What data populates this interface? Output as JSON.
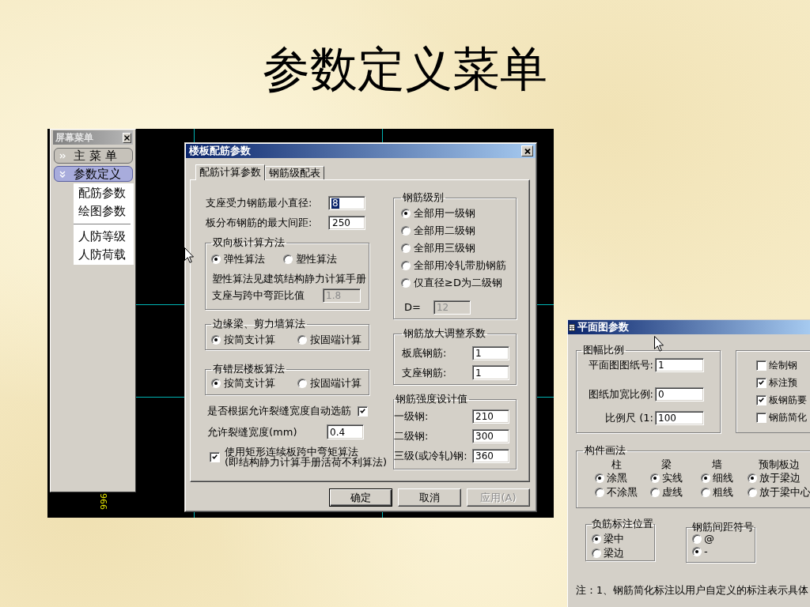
{
  "slide": {
    "title": "参数定义菜单"
  },
  "cad_screen": {
    "canvas_text": "966",
    "screen_menu": {
      "title": "屏幕菜单",
      "buttons": [
        {
          "label": "主 菜 单",
          "expanded": false
        },
        {
          "label": "参数定义",
          "expanded": true,
          "item_groups": [
            [
              "配筋参数",
              "绘图参数"
            ],
            [
              "人防等级",
              "人防荷载"
            ]
          ]
        }
      ]
    },
    "dialog": {
      "title": "楼板配筋参数",
      "tabs": [
        {
          "label": "配筋计算参数",
          "selected": true
        },
        {
          "label": "钢筋级配表",
          "selected": false
        }
      ],
      "fields": [
        {
          "label": "支座受力钢筋最小直径:",
          "value": "8",
          "text_selected": true
        },
        {
          "label": "板分布钢筋的最大间距:",
          "value": "250",
          "text_selected": false
        }
      ],
      "two_way_slab": {
        "title": "双向板计算方法",
        "options": [
          {
            "label": "弹性算法",
            "selected": true
          },
          {
            "label": "塑性算法",
            "selected": false
          }
        ],
        "note": "塑性算法见建筑结构静力计算手册",
        "ratio": {
          "label": "支座与跨中弯距比值",
          "value": "1.8",
          "disabled": true
        }
      },
      "edge_beam": {
        "title": "边缘梁、剪力墙算法",
        "options": [
          {
            "label": "按简支计算",
            "selected": true
          },
          {
            "label": "按固端计算",
            "selected": false
          }
        ]
      },
      "staggered_slab": {
        "title": "有错层楼板算法",
        "options": [
          {
            "label": "按简支计算",
            "selected": true
          },
          {
            "label": "按固端计算",
            "selected": false
          }
        ]
      },
      "auto_select": {
        "label": "是否根据允许裂缝宽度自动选筋",
        "checked": true
      },
      "crack_width": {
        "label": "允许裂缝宽度(mm)",
        "value": "0.4"
      },
      "moment_method": {
        "lines": [
          "使用矩形连续板跨中弯矩算法",
          "(即结构静力计算手册活荷不利算法)"
        ],
        "checked": true
      },
      "steel_grade": {
        "title": "钢筋级别",
        "options": [
          {
            "label": "全部用一级钢",
            "selected": true
          },
          {
            "label": "全部用二级钢",
            "selected": false
          },
          {
            "label": "全部用三级钢",
            "selected": false
          },
          {
            "label": "全部用冷轧带肋钢筋",
            "selected": false
          },
          {
            "label": "仅直径≥D为二级钢",
            "selected": false
          }
        ],
        "d_field": {
          "label": "D=",
          "value": "12",
          "disabled": true
        }
      },
      "amplification": {
        "title": "钢筋放大调整系数",
        "fields": [
          {
            "label": "板底钢筋:",
            "value": "1"
          },
          {
            "label": "支座钢筋:",
            "value": "1"
          }
        ]
      },
      "strength": {
        "title": "钢筋强度设计值",
        "fields": [
          {
            "label": "一级钢:",
            "value": "210"
          },
          {
            "label": "二级钢:",
            "value": "300"
          },
          {
            "label": "三级(或冷轧)钢:",
            "value": "360"
          }
        ]
      },
      "buttons": [
        {
          "label": "确定",
          "default": true,
          "disabled": false
        },
        {
          "label": "取消",
          "default": false,
          "disabled": false
        },
        {
          "label": "应用(A)",
          "default": false,
          "disabled": true
        }
      ]
    }
  },
  "plan_dialog": {
    "title": "平面图参数",
    "scale": {
      "title": "图幅比例",
      "fields": [
        {
          "label": "平面图图纸号:",
          "value": "1"
        },
        {
          "label": "图纸加宽比例:",
          "value": "0"
        },
        {
          "label": "比例尺 (1:",
          "value": "100"
        }
      ]
    },
    "options": [
      {
        "label": "绘制钢",
        "checked": false
      },
      {
        "label": "标注预",
        "checked": true
      },
      {
        "label": "板钢筋要",
        "checked": true
      },
      {
        "label": "钢筋简化",
        "checked": false
      }
    ],
    "drawing_methods": {
      "title": "构件画法",
      "columns": [
        {
          "header": "柱",
          "options": [
            {
              "label": "涂黑",
              "selected": true
            },
            {
              "label": "不涂黑",
              "selected": false
            }
          ]
        },
        {
          "header": "梁",
          "options": [
            {
              "label": "实线",
              "selected": true
            },
            {
              "label": "虚线",
              "selected": false
            }
          ]
        },
        {
          "header": "墙",
          "options": [
            {
              "label": "细线",
              "selected": true
            },
            {
              "label": "粗线",
              "selected": false
            }
          ]
        },
        {
          "header": "预制板边",
          "options": [
            {
              "label": "放于梁边",
              "selected": true
            },
            {
              "label": "放于梁中心",
              "selected": false
            }
          ]
        }
      ]
    },
    "neg_rebar_position": {
      "title": "负筋标注位置",
      "options": [
        {
          "label": "梁中",
          "selected": true
        },
        {
          "label": "梁边",
          "selected": false
        }
      ]
    },
    "spacing_symbol": {
      "title": "钢筋间距符号",
      "options": [
        {
          "label": "@",
          "selected": false
        },
        {
          "label": "-",
          "selected": true
        }
      ]
    },
    "note": "注：1、钢筋简化标注以用户自定义的标注表示具体"
  }
}
